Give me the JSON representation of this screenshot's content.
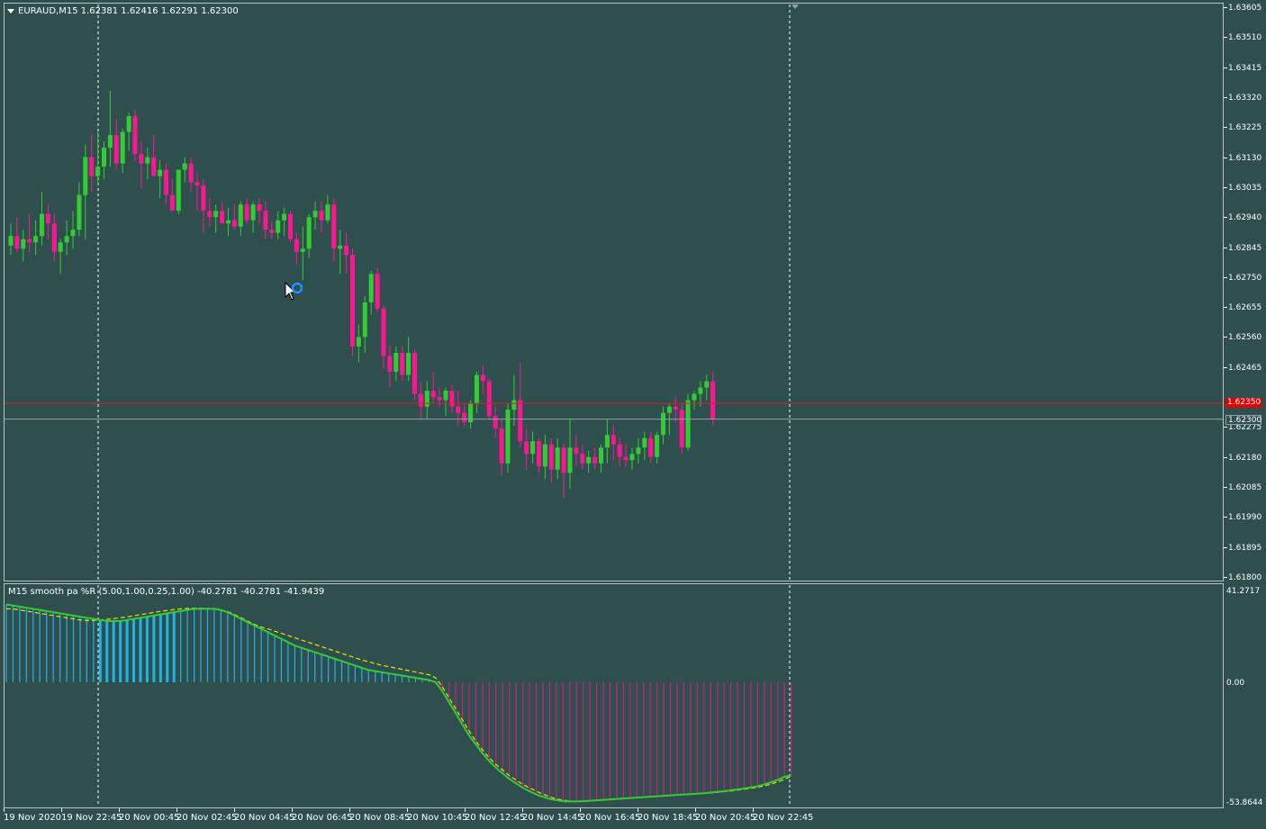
{
  "chart": {
    "title": "EURAUD,M15  1.62381 1.62416 1.62291 1.62300",
    "price_labels": [
      "1.63605",
      "1.63510",
      "1.63415",
      "1.63320",
      "1.63225",
      "1.63130",
      "1.63035",
      "1.62940",
      "1.62845",
      "1.62750",
      "1.62655",
      "1.62560",
      "1.62465",
      "1.62275",
      "1.62180",
      "1.62085",
      "1.61990",
      "1.61895",
      "1.61800"
    ],
    "bid_tag": "1.62300",
    "ask_tag": "1.62350",
    "colors": {
      "background": "#2f4f4f",
      "bull": "#32cd32",
      "bear": "#ff1493",
      "ask_line": "#d42020",
      "bid_line": "#8fa3a3",
      "grid": "#ffffff"
    }
  },
  "chart_data": [
    {
      "type": "candlestick",
      "symbol": "EURAUD",
      "timeframe": "M15",
      "ylim": [
        1.618,
        1.63605
      ],
      "candles": [
        {
          "o": 1.6285,
          "h": 1.6292,
          "l": 1.6282,
          "c": 1.6288
        },
        {
          "o": 1.6288,
          "h": 1.6294,
          "l": 1.6283,
          "c": 1.6284
        },
        {
          "o": 1.6284,
          "h": 1.629,
          "l": 1.628,
          "c": 1.6287
        },
        {
          "o": 1.6287,
          "h": 1.6295,
          "l": 1.6283,
          "c": 1.6286
        },
        {
          "o": 1.6286,
          "h": 1.6293,
          "l": 1.6282,
          "c": 1.6288
        },
        {
          "o": 1.6288,
          "h": 1.6302,
          "l": 1.6285,
          "c": 1.6295
        },
        {
          "o": 1.6295,
          "h": 1.6298,
          "l": 1.6287,
          "c": 1.6292
        },
        {
          "o": 1.6292,
          "h": 1.6295,
          "l": 1.628,
          "c": 1.6283
        },
        {
          "o": 1.6283,
          "h": 1.6287,
          "l": 1.6276,
          "c": 1.6286
        },
        {
          "o": 1.6286,
          "h": 1.6293,
          "l": 1.6282,
          "c": 1.6288
        },
        {
          "o": 1.6288,
          "h": 1.6296,
          "l": 1.6284,
          "c": 1.629
        },
        {
          "o": 1.629,
          "h": 1.6305,
          "l": 1.6288,
          "c": 1.6301
        },
        {
          "o": 1.6301,
          "h": 1.6317,
          "l": 1.6287,
          "c": 1.6313
        },
        {
          "o": 1.6313,
          "h": 1.632,
          "l": 1.6302,
          "c": 1.6307
        },
        {
          "o": 1.6307,
          "h": 1.6321,
          "l": 1.6304,
          "c": 1.631
        },
        {
          "o": 1.631,
          "h": 1.6318,
          "l": 1.6306,
          "c": 1.6316
        },
        {
          "o": 1.6316,
          "h": 1.6334,
          "l": 1.631,
          "c": 1.632
        },
        {
          "o": 1.632,
          "h": 1.6325,
          "l": 1.6309,
          "c": 1.6311
        },
        {
          "o": 1.6311,
          "h": 1.6322,
          "l": 1.6308,
          "c": 1.6321
        },
        {
          "o": 1.6321,
          "h": 1.6327,
          "l": 1.6315,
          "c": 1.6326
        },
        {
          "o": 1.6326,
          "h": 1.6328,
          "l": 1.6312,
          "c": 1.6314
        },
        {
          "o": 1.6314,
          "h": 1.6318,
          "l": 1.6303,
          "c": 1.6311
        },
        {
          "o": 1.6311,
          "h": 1.6316,
          "l": 1.6306,
          "c": 1.6313
        },
        {
          "o": 1.6313,
          "h": 1.632,
          "l": 1.6308,
          "c": 1.6307
        },
        {
          "o": 1.6307,
          "h": 1.6312,
          "l": 1.63,
          "c": 1.6309
        },
        {
          "o": 1.6309,
          "h": 1.6311,
          "l": 1.6298,
          "c": 1.6301
        },
        {
          "o": 1.6301,
          "h": 1.6306,
          "l": 1.6296,
          "c": 1.6296
        },
        {
          "o": 1.6296,
          "h": 1.6309,
          "l": 1.6295,
          "c": 1.6309
        },
        {
          "o": 1.6309,
          "h": 1.6313,
          "l": 1.6305,
          "c": 1.6311
        },
        {
          "o": 1.6311,
          "h": 1.6313,
          "l": 1.6302,
          "c": 1.6305
        },
        {
          "o": 1.6305,
          "h": 1.6308,
          "l": 1.6296,
          "c": 1.6304
        },
        {
          "o": 1.6304,
          "h": 1.6306,
          "l": 1.6289,
          "c": 1.6296
        },
        {
          "o": 1.6296,
          "h": 1.63,
          "l": 1.6291,
          "c": 1.6294
        },
        {
          "o": 1.6294,
          "h": 1.6298,
          "l": 1.6289,
          "c": 1.6296
        },
        {
          "o": 1.6296,
          "h": 1.6299,
          "l": 1.6292,
          "c": 1.6292
        },
        {
          "o": 1.6292,
          "h": 1.6297,
          "l": 1.6288,
          "c": 1.6293
        },
        {
          "o": 1.6293,
          "h": 1.6298,
          "l": 1.629,
          "c": 1.6291
        },
        {
          "o": 1.6291,
          "h": 1.6299,
          "l": 1.6288,
          "c": 1.6298
        },
        {
          "o": 1.6298,
          "h": 1.63,
          "l": 1.6292,
          "c": 1.6293
        },
        {
          "o": 1.6293,
          "h": 1.6299,
          "l": 1.6289,
          "c": 1.6298
        },
        {
          "o": 1.6298,
          "h": 1.63,
          "l": 1.6292,
          "c": 1.6296
        },
        {
          "o": 1.6296,
          "h": 1.6299,
          "l": 1.6287,
          "c": 1.629
        },
        {
          "o": 1.629,
          "h": 1.6293,
          "l": 1.6287,
          "c": 1.6289
        },
        {
          "o": 1.6289,
          "h": 1.6296,
          "l": 1.6287,
          "c": 1.6293
        },
        {
          "o": 1.6293,
          "h": 1.6297,
          "l": 1.6288,
          "c": 1.6295
        },
        {
          "o": 1.6295,
          "h": 1.6296,
          "l": 1.6286,
          "c": 1.6287
        },
        {
          "o": 1.6287,
          "h": 1.6289,
          "l": 1.6279,
          "c": 1.6283
        },
        {
          "o": 1.6283,
          "h": 1.6291,
          "l": 1.6274,
          "c": 1.6284
        },
        {
          "o": 1.6284,
          "h": 1.6295,
          "l": 1.6281,
          "c": 1.6294
        },
        {
          "o": 1.6294,
          "h": 1.6299,
          "l": 1.629,
          "c": 1.6296
        },
        {
          "o": 1.6296,
          "h": 1.6299,
          "l": 1.6289,
          "c": 1.6293
        },
        {
          "o": 1.6293,
          "h": 1.6301,
          "l": 1.6292,
          "c": 1.6298
        },
        {
          "o": 1.6298,
          "h": 1.63,
          "l": 1.628,
          "c": 1.6284
        },
        {
          "o": 1.6284,
          "h": 1.629,
          "l": 1.6276,
          "c": 1.6285
        },
        {
          "o": 1.6285,
          "h": 1.6289,
          "l": 1.6276,
          "c": 1.6282
        },
        {
          "o": 1.6282,
          "h": 1.6284,
          "l": 1.625,
          "c": 1.6253
        },
        {
          "o": 1.6253,
          "h": 1.626,
          "l": 1.6248,
          "c": 1.6256
        },
        {
          "o": 1.6256,
          "h": 1.6269,
          "l": 1.6251,
          "c": 1.6267
        },
        {
          "o": 1.6267,
          "h": 1.6277,
          "l": 1.6263,
          "c": 1.6276
        },
        {
          "o": 1.6276,
          "h": 1.6278,
          "l": 1.6264,
          "c": 1.6265
        },
        {
          "o": 1.6265,
          "h": 1.6266,
          "l": 1.6246,
          "c": 1.625
        },
        {
          "o": 1.625,
          "h": 1.6253,
          "l": 1.624,
          "c": 1.6245
        },
        {
          "o": 1.6245,
          "h": 1.6253,
          "l": 1.6242,
          "c": 1.6251
        },
        {
          "o": 1.6251,
          "h": 1.6253,
          "l": 1.6242,
          "c": 1.6244
        },
        {
          "o": 1.6244,
          "h": 1.6256,
          "l": 1.6242,
          "c": 1.6251
        },
        {
          "o": 1.6251,
          "h": 1.6252,
          "l": 1.6236,
          "c": 1.6238
        },
        {
          "o": 1.6238,
          "h": 1.6242,
          "l": 1.623,
          "c": 1.6234
        },
        {
          "o": 1.6234,
          "h": 1.6242,
          "l": 1.623,
          "c": 1.6239
        },
        {
          "o": 1.6239,
          "h": 1.6245,
          "l": 1.6235,
          "c": 1.6237
        },
        {
          "o": 1.6237,
          "h": 1.624,
          "l": 1.6234,
          "c": 1.6236
        },
        {
          "o": 1.6236,
          "h": 1.624,
          "l": 1.6231,
          "c": 1.6239
        },
        {
          "o": 1.6239,
          "h": 1.6241,
          "l": 1.6232,
          "c": 1.6234
        },
        {
          "o": 1.6234,
          "h": 1.6239,
          "l": 1.6228,
          "c": 1.6232
        },
        {
          "o": 1.6232,
          "h": 1.6235,
          "l": 1.6228,
          "c": 1.6229
        },
        {
          "o": 1.6229,
          "h": 1.6236,
          "l": 1.6227,
          "c": 1.6235
        },
        {
          "o": 1.6235,
          "h": 1.6245,
          "l": 1.6232,
          "c": 1.6244
        },
        {
          "o": 1.6244,
          "h": 1.6247,
          "l": 1.6238,
          "c": 1.6242
        },
        {
          "o": 1.6242,
          "h": 1.6243,
          "l": 1.623,
          "c": 1.6231
        },
        {
          "o": 1.6231,
          "h": 1.6234,
          "l": 1.6224,
          "c": 1.6227
        },
        {
          "o": 1.6227,
          "h": 1.623,
          "l": 1.6212,
          "c": 1.6216
        },
        {
          "o": 1.6216,
          "h": 1.6235,
          "l": 1.6213,
          "c": 1.6233
        },
        {
          "o": 1.6233,
          "h": 1.6244,
          "l": 1.6228,
          "c": 1.6236
        },
        {
          "o": 1.6236,
          "h": 1.6248,
          "l": 1.6221,
          "c": 1.6223
        },
        {
          "o": 1.6223,
          "h": 1.6227,
          "l": 1.6214,
          "c": 1.6219
        },
        {
          "o": 1.6219,
          "h": 1.6226,
          "l": 1.6216,
          "c": 1.6223
        },
        {
          "o": 1.6223,
          "h": 1.6224,
          "l": 1.6213,
          "c": 1.6215
        },
        {
          "o": 1.6215,
          "h": 1.6225,
          "l": 1.6211,
          "c": 1.6222
        },
        {
          "o": 1.6222,
          "h": 1.6224,
          "l": 1.621,
          "c": 1.6214
        },
        {
          "o": 1.6214,
          "h": 1.6224,
          "l": 1.6211,
          "c": 1.6221
        },
        {
          "o": 1.6221,
          "h": 1.6222,
          "l": 1.6205,
          "c": 1.6213
        },
        {
          "o": 1.6213,
          "h": 1.623,
          "l": 1.6208,
          "c": 1.6221
        },
        {
          "o": 1.6221,
          "h": 1.6225,
          "l": 1.6215,
          "c": 1.6219
        },
        {
          "o": 1.6219,
          "h": 1.6222,
          "l": 1.6214,
          "c": 1.6216
        },
        {
          "o": 1.6216,
          "h": 1.622,
          "l": 1.6213,
          "c": 1.6218
        },
        {
          "o": 1.6218,
          "h": 1.6221,
          "l": 1.6214,
          "c": 1.6216
        },
        {
          "o": 1.6216,
          "h": 1.6222,
          "l": 1.6213,
          "c": 1.6221
        },
        {
          "o": 1.6221,
          "h": 1.623,
          "l": 1.6216,
          "c": 1.6225
        },
        {
          "o": 1.6225,
          "h": 1.6228,
          "l": 1.6217,
          "c": 1.6222
        },
        {
          "o": 1.6222,
          "h": 1.6224,
          "l": 1.6215,
          "c": 1.6218
        },
        {
          "o": 1.6218,
          "h": 1.6222,
          "l": 1.6215,
          "c": 1.6217
        },
        {
          "o": 1.6217,
          "h": 1.6221,
          "l": 1.6214,
          "c": 1.6219
        },
        {
          "o": 1.6219,
          "h": 1.6224,
          "l": 1.6216,
          "c": 1.6221
        },
        {
          "o": 1.6221,
          "h": 1.6226,
          "l": 1.6217,
          "c": 1.6224
        },
        {
          "o": 1.6224,
          "h": 1.6226,
          "l": 1.6216,
          "c": 1.6218
        },
        {
          "o": 1.6218,
          "h": 1.6226,
          "l": 1.6216,
          "c": 1.6225
        },
        {
          "o": 1.6225,
          "h": 1.6234,
          "l": 1.6222,
          "c": 1.6232
        },
        {
          "o": 1.6232,
          "h": 1.6235,
          "l": 1.6225,
          "c": 1.6234
        },
        {
          "o": 1.6234,
          "h": 1.6237,
          "l": 1.6229,
          "c": 1.6233
        },
        {
          "o": 1.6233,
          "h": 1.6235,
          "l": 1.6219,
          "c": 1.6221
        },
        {
          "o": 1.6221,
          "h": 1.6238,
          "l": 1.622,
          "c": 1.6236
        },
        {
          "o": 1.6236,
          "h": 1.6239,
          "l": 1.6233,
          "c": 1.6238
        },
        {
          "o": 1.6238,
          "h": 1.6242,
          "l": 1.6234,
          "c": 1.624
        },
        {
          "o": 1.624,
          "h": 1.6244,
          "l": 1.6236,
          "c": 1.6242
        },
        {
          "o": 1.6242,
          "h": 1.6245,
          "l": 1.6228,
          "c": 1.623
        }
      ]
    },
    {
      "type": "histogram",
      "name": "smooth pa %R (5.00,1.00,0.25,1.00)",
      "ylim": [
        -53.8644,
        41.2717
      ],
      "values": [
        35,
        34.5,
        34,
        33.5,
        33,
        32.5,
        32,
        31.5,
        31,
        30.5,
        30,
        29.5,
        29,
        28.5,
        28,
        27.5,
        27.5,
        27.5,
        28,
        28.5,
        29,
        29.5,
        30,
        30.5,
        31,
        31.5,
        32,
        32.5,
        33,
        33,
        33,
        33,
        32.5,
        31.5,
        30,
        28.5,
        27,
        25.5,
        24,
        22.5,
        21,
        19.5,
        18,
        16.5,
        15.5,
        14.5,
        13.5,
        12.5,
        11.5,
        10.5,
        9.5,
        8.5,
        7.5,
        6.5,
        5.5,
        5,
        4.5,
        4,
        3.5,
        3,
        2.5,
        2,
        1.5,
        1,
        0,
        -4,
        -9,
        -14,
        -19,
        -24,
        -28,
        -32,
        -35.5,
        -38.5,
        -41,
        -43.5,
        -45.5,
        -47.5,
        -49,
        -50.5,
        -51.5,
        -52.5,
        -53,
        -53.5,
        -53.6,
        -53.6,
        -53.5,
        -53.3,
        -53.1,
        -52.9,
        -52.7,
        -52.5,
        -52.3,
        -52.1,
        -51.9,
        -51.7,
        -51.5,
        -51.3,
        -51.1,
        -50.9,
        -50.7,
        -50.5,
        -50.3,
        -50.1,
        -49.9,
        -49.6,
        -49.3,
        -49,
        -48.6,
        -48.2,
        -47.8,
        -47.3,
        -46.8,
        -45.9,
        -45,
        -43.9,
        -42.5,
        -41.9
      ],
      "signal_values": [
        33,
        33,
        32.5,
        32,
        31.5,
        31,
        30.5,
        30,
        29.5,
        29,
        28.5,
        28,
        27.8,
        27.8,
        28,
        28.3,
        28.6,
        29,
        29.4,
        29.9,
        30.4,
        30.9,
        31.4,
        31.9,
        32.3,
        32.7,
        33,
        33.2,
        33.3,
        33.3,
        33.2,
        33,
        32.5,
        31.8,
        30.5,
        29,
        27.5,
        26,
        24.8,
        24,
        23,
        22,
        21,
        20,
        19,
        18,
        17,
        16,
        15,
        14,
        13,
        12,
        11,
        10,
        9.2,
        8.4,
        7.6,
        7,
        6.4,
        5.8,
        5.2,
        4.6,
        4,
        3.4,
        2,
        -2,
        -7,
        -12,
        -17,
        -22,
        -26.5,
        -30.5,
        -34,
        -37,
        -39.5,
        -42,
        -44,
        -46,
        -47.5,
        -49,
        -50.3,
        -51.5,
        -52.5,
        -53,
        -53.4,
        -53.6,
        -53.6,
        -53.4,
        -53.2,
        -53,
        -52.8,
        -52.6,
        -52.4,
        -52.2,
        -52,
        -51.8,
        -51.6,
        -51.4,
        -51.2,
        -51,
        -50.8,
        -50.6,
        -50.4,
        -50.2,
        -50,
        -49.8,
        -49.5,
        -49.2,
        -48.9,
        -48.5,
        -48.1,
        -47.7,
        -47.2,
        -46.6,
        -45.8,
        -44.8,
        -43.6,
        -42.3
      ]
    }
  ],
  "indicator": {
    "title": "M15  smooth pa %R (5.00,1.00,0.25,1.00) -40.2781 -40.2781 -41.9439",
    "labels": [
      "41.2717",
      "0.00",
      "-53.8644"
    ],
    "colors": {
      "positive": "#1eb4e6",
      "negative": "#d41a80",
      "line": "#32cd32",
      "signal": "#e6e600"
    }
  },
  "time_axis": {
    "labels": [
      "19 Nov 2020",
      "19 Nov 22:45",
      "20 Nov 00:45",
      "20 Nov 02:45",
      "20 Nov 04:45",
      "20 Nov 06:45",
      "20 Nov 08:45",
      "20 Nov 10:45",
      "20 Nov 12:45",
      "20 Nov 14:45",
      "20 Nov 16:45",
      "20 Nov 18:45",
      "20 Nov 20:45",
      "20 Nov 22:45"
    ]
  }
}
